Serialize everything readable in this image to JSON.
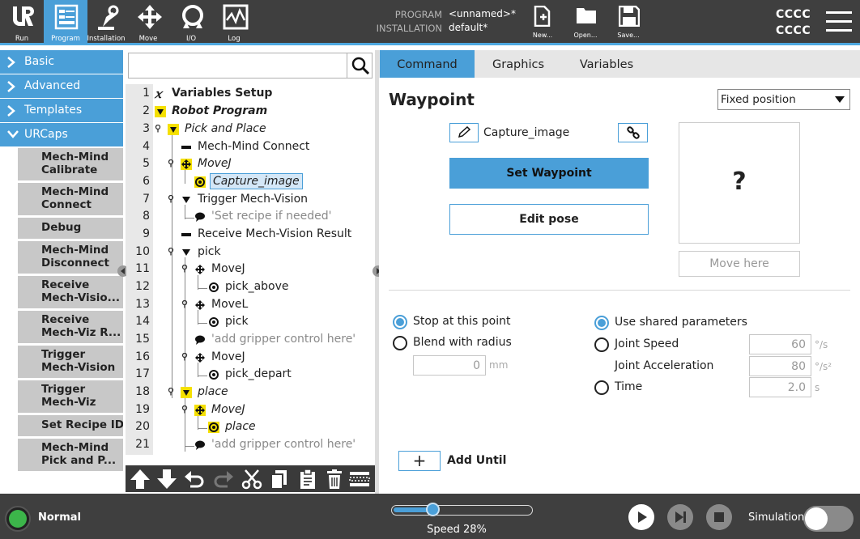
{
  "topbar": {
    "nav": [
      {
        "id": "run",
        "label": "Run",
        "icon": "ur-logo-icon"
      },
      {
        "id": "program",
        "label": "Program",
        "icon": "program-icon",
        "active": true
      },
      {
        "id": "installation",
        "label": "Installation",
        "icon": "installation-icon"
      },
      {
        "id": "move",
        "label": "Move",
        "icon": "move-arrows-icon"
      },
      {
        "id": "io",
        "label": "I/O",
        "icon": "io-icon"
      },
      {
        "id": "log",
        "label": "Log",
        "icon": "log-icon"
      }
    ],
    "program_label": "PROGRAM",
    "program_value": "<unnamed>*",
    "installation_label": "INSTALLATION",
    "installation_value": "default*",
    "file_buttons": [
      {
        "label": "New...",
        "icon": "new-file-icon"
      },
      {
        "label": "Open...",
        "icon": "open-folder-icon"
      },
      {
        "label": "Save...",
        "icon": "save-icon"
      }
    ],
    "user_line1": "CCCC",
    "user_line2": "CCCC",
    "accent_color": "#4a9fd8"
  },
  "sidebar": {
    "categories": [
      {
        "label": "Basic",
        "expanded": false
      },
      {
        "label": "Advanced",
        "expanded": false
      },
      {
        "label": "Templates",
        "expanded": false
      },
      {
        "label": "URCaps",
        "expanded": true
      }
    ],
    "urcaps": [
      "Mech-Mind\nCalibrate",
      "Mech-Mind\nConnect",
      "Debug",
      "Mech-Mind\nDisconnect",
      "Receive\nMech-Visio...",
      "Receive\nMech-Viz R...",
      "Trigger\nMech-Vision",
      "Trigger\nMech-Viz",
      "Set Recipe ID",
      "Mech-Mind\nPick and P..."
    ]
  },
  "search": {
    "placeholder": ""
  },
  "tree": {
    "lines": [
      {
        "n": "1",
        "text": "Variables Setup",
        "style": "b",
        "icon": "variable-x-icon"
      },
      {
        "n": "2",
        "text": "Robot Program",
        "style": "bi",
        "icon": "yellow-triangle-icon"
      },
      {
        "n": "3",
        "text": "Pick and Place",
        "style": "i",
        "icon": "yellow-triangle-icon"
      },
      {
        "n": "4",
        "text": "Mech-Mind Connect",
        "style": "",
        "icon": "dash-icon"
      },
      {
        "n": "5",
        "text": "MoveJ",
        "style": "i",
        "icon": "move-yellow-icon"
      },
      {
        "n": "6",
        "text": "Capture_image",
        "style": "i",
        "icon": "waypoint-yellow-icon",
        "selected": true
      },
      {
        "n": "7",
        "text": "Trigger Mech-Vision",
        "style": "",
        "icon": "triangle-icon"
      },
      {
        "n": "8",
        "text": "'Set recipe if needed'",
        "style": "gray",
        "icon": "comment-icon"
      },
      {
        "n": "9",
        "text": "Receive Mech-Vision Result",
        "style": "",
        "icon": "dash-icon"
      },
      {
        "n": "10",
        "text": "pick",
        "style": "",
        "icon": "triangle-icon"
      },
      {
        "n": "11",
        "text": "MoveJ",
        "style": "",
        "icon": "move-icon"
      },
      {
        "n": "12",
        "text": "pick_above",
        "style": "",
        "icon": "waypoint-icon"
      },
      {
        "n": "13",
        "text": "MoveL",
        "style": "",
        "icon": "move-icon"
      },
      {
        "n": "14",
        "text": "pick",
        "style": "",
        "icon": "waypoint-icon"
      },
      {
        "n": "15",
        "text": "'add gripper control here'",
        "style": "gray",
        "icon": "comment-icon"
      },
      {
        "n": "16",
        "text": "MoveJ",
        "style": "",
        "icon": "move-icon"
      },
      {
        "n": "17",
        "text": "pick_depart",
        "style": "",
        "icon": "waypoint-icon"
      },
      {
        "n": "18",
        "text": "place",
        "style": "i",
        "icon": "yellow-triangle-icon"
      },
      {
        "n": "19",
        "text": "MoveJ",
        "style": "i",
        "icon": "move-yellow-icon"
      },
      {
        "n": "20",
        "text": "place",
        "style": "i",
        "icon": "waypoint-yellow-icon"
      },
      {
        "n": "21",
        "text": "'add gripper control here'",
        "style": "gray",
        "icon": "comment-icon"
      }
    ]
  },
  "toolbar_icons": [
    "move-up-icon",
    "move-down-icon",
    "undo-icon",
    "redo-icon",
    "cut-icon",
    "copy-icon",
    "paste-icon",
    "delete-icon",
    "suppress-icon"
  ],
  "tabs": [
    {
      "label": "Command",
      "active": true
    },
    {
      "label": "Graphics",
      "active": false
    },
    {
      "label": "Variables",
      "active": false
    }
  ],
  "command": {
    "title": "Waypoint",
    "position_select": "Fixed position",
    "waypoint_name": "Capture_image",
    "set_waypoint": "Set Waypoint",
    "edit_pose": "Edit pose",
    "preview_symbol": "?",
    "move_here": "Move here",
    "stop_at_point": "Stop at this point",
    "blend_with_radius": "Blend with radius",
    "blend_value": "0",
    "blend_unit": "mm",
    "use_shared": "Use shared parameters",
    "joint_speed": "Joint Speed",
    "joint_speed_value": "60",
    "joint_speed_unit": "°/s",
    "joint_accel": "Joint Acceleration",
    "joint_accel_value": "80",
    "joint_accel_unit": "°/s²",
    "time": "Time",
    "time_value": "2.0",
    "time_unit": "s",
    "add_until": "Add Until",
    "add_symbol": "+"
  },
  "bottombar": {
    "status": "Normal",
    "status_color": "#3cb54a",
    "speed_text": "Speed 28%",
    "speed_fraction": 0.28,
    "simulation": "Simulation"
  }
}
